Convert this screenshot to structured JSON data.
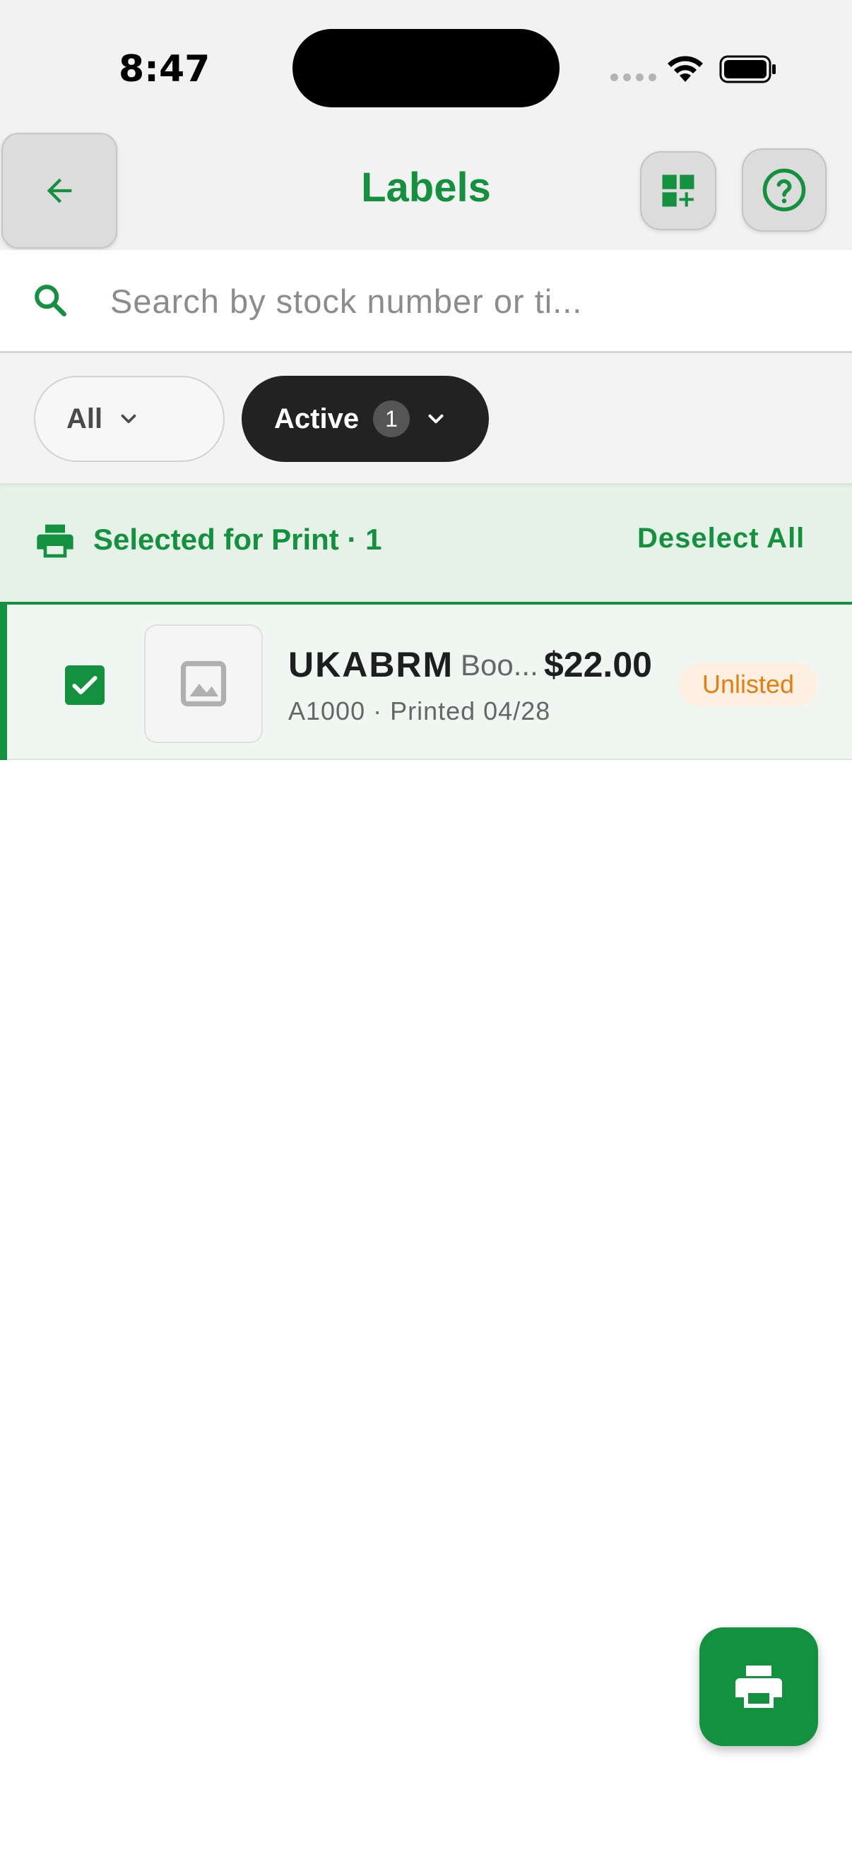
{
  "status_bar": {
    "time": "8:47"
  },
  "header": {
    "title": "Labels",
    "back_icon": "arrow-left-icon",
    "add_icon": "grid-add-icon",
    "help_icon": "help-circle-icon"
  },
  "search": {
    "placeholder": "Search by stock number or ti...",
    "value": ""
  },
  "filters": {
    "all_label": "All",
    "active_label": "Active",
    "active_count": "1"
  },
  "selection": {
    "text": "Selected for Print · 1",
    "deselect_label": "Deselect All"
  },
  "items": [
    {
      "code": "UKABRM",
      "title": "Boo...",
      "price": "$22.00",
      "meta": "A1000 · Printed 04/28",
      "status": "Unlisted",
      "checked": true
    }
  ],
  "colors": {
    "accent": "#14913f",
    "warning": "#e67e0e",
    "dark_chip": "#222222"
  }
}
